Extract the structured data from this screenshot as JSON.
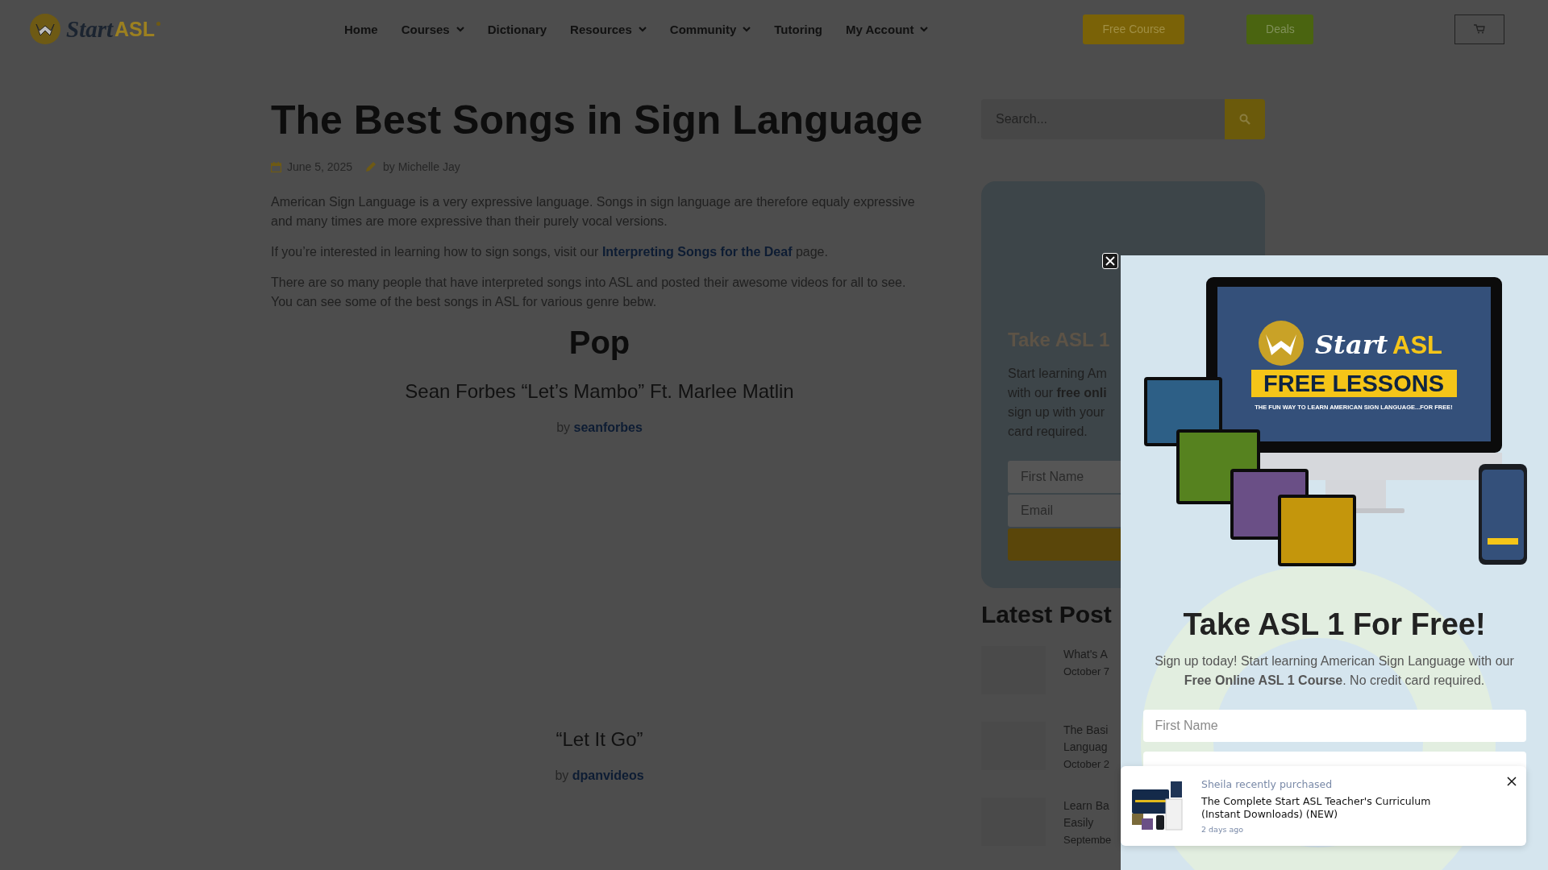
{
  "header": {
    "logo": {
      "start": "Start",
      "asl": "ASL"
    },
    "nav": [
      {
        "label": "Home",
        "dropdown": false
      },
      {
        "label": "Courses",
        "dropdown": true
      },
      {
        "label": "Dictionary",
        "dropdown": false
      },
      {
        "label": "Resources",
        "dropdown": true
      },
      {
        "label": "Community",
        "dropdown": true
      },
      {
        "label": "Tutoring",
        "dropdown": false
      },
      {
        "label": "My Account",
        "dropdown": true
      }
    ],
    "buttons": [
      {
        "label": "Free Course",
        "kind": "gold"
      },
      {
        "label": "Deals",
        "kind": "green"
      }
    ]
  },
  "article": {
    "title": "The Best Songs in Sign Language",
    "date": "June 5, 2025",
    "author": "by Michelle Jay",
    "paragraphs": [
      {
        "segments": [
          {
            "text": "American Sign Language is a very expressive language. Songs in sign language are therefore equaly expressive and many times are more expressive than their purely vocal versions.",
            "link": false
          }
        ]
      },
      {
        "segments": [
          {
            "text": "If you’re interested in learning how to sign songs, visit our ",
            "link": false
          },
          {
            "text": "Interpreting Songs for the Deaf",
            "link": true
          },
          {
            "text": " page.",
            "link": false
          }
        ]
      },
      {
        "segments": [
          {
            "text": "There are so many people that have interpreted songs into ASL and posted their awesome videos for all to see. You can see some of the best songs in ASL for various genre bebw.",
            "link": false
          }
        ]
      }
    ],
    "sections": [
      {
        "heading": "Pop",
        "songs": [
          {
            "title": "Sean Forbes “Let’s Mambo” Ft. Marlee Matlin",
            "by": "by",
            "channel": "seanforbes"
          },
          {
            "title": "“Let It Go”",
            "by": "by",
            "channel": "dpanvideos"
          }
        ]
      }
    ]
  },
  "sidebar": {
    "search": {
      "placeholder": "Search..."
    },
    "card": {
      "title": "Take ASL 1",
      "lines": [
        "Start learning Am",
        "with our **free onli**",
        "sign up with your",
        "card required."
      ],
      "fields": [
        {
          "placeholder": "First Name"
        },
        {
          "placeholder": "Email"
        }
      ]
    },
    "latest": {
      "title": "Latest Post",
      "posts": [
        {
          "lines": [
            "What's A"
          ],
          "date": "October 7"
        },
        {
          "lines": [
            "The Basi",
            "Languag"
          ],
          "date": "October 2"
        },
        {
          "lines": [
            "Learn Ba",
            "Easily"
          ],
          "date": "Septembe"
        }
      ]
    }
  },
  "popup": {
    "promo": {
      "brand_start": "Start",
      "brand_asl": "ASL",
      "banner": "FREE LESSONS",
      "tagline": "THE FUN WAY TO LEARN AMERICAN SIGN LANGUAGE...FOR FREE!"
    },
    "headline": "Take ASL 1 For Free!",
    "body": "Sign up today! Start learning American Sign Language with our **Free Online ASL 1 Course**. No credit card required.",
    "fields": [
      {
        "placeholder": "First Name"
      }
    ]
  },
  "notification": {
    "buyer_line": "Sheila recently purchased",
    "product": "The Complete Start ASL Teacher's Curriculum (Instant Downloads) (NEW)",
    "time": "2 days ago"
  }
}
